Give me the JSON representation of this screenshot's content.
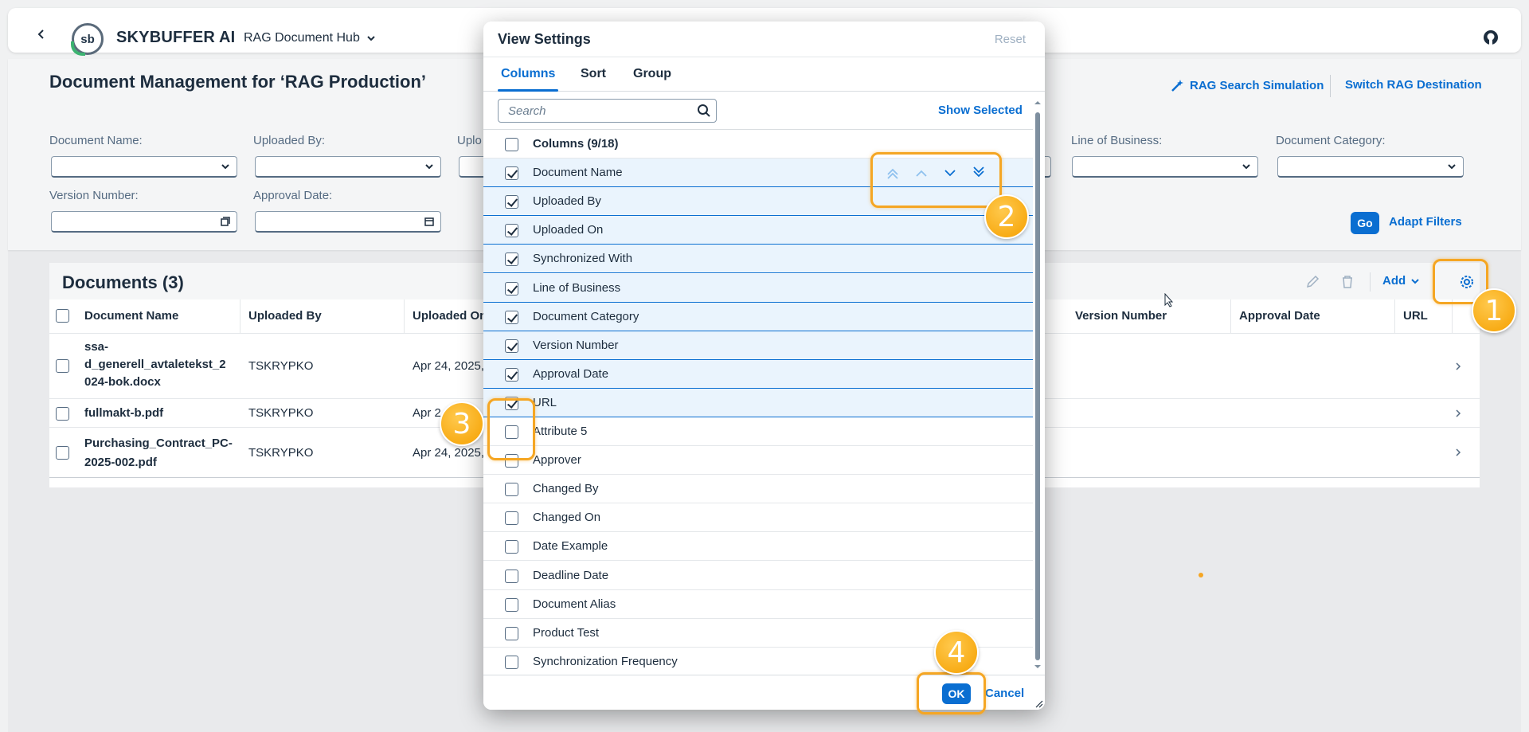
{
  "shell": {
    "brand": "SKYBUFFER AI",
    "logo_text": "sb",
    "product": "RAG Document Hub"
  },
  "page": {
    "title": "Document Management for ‘RAG Production’",
    "links": {
      "search_sim": "RAG Search Simulation",
      "switch_dest": "Switch RAG Destination"
    },
    "filters": {
      "document_name": "Document Name:",
      "uploaded_by": "Uploaded By:",
      "uploaded_on_partial": "Uplo",
      "line_of_business": "Line of Business:",
      "document_category": "Document Category:",
      "version_number": "Version Number:",
      "approval_date": "Approval Date:"
    },
    "go": "Go",
    "adapt_filters": "Adapt Filters"
  },
  "table": {
    "title": "Documents (3)",
    "add": "Add",
    "columns": {
      "document_name": "Document Name",
      "uploaded_by": "Uploaded By",
      "uploaded_on": "Uploaded On",
      "version_number": "Version Number",
      "approval_date": "Approval Date",
      "url": "URL"
    },
    "rows": [
      {
        "name_l1": "ssa-",
        "name_l2": "d_generell_avtaletekst_2",
        "name_l3": "024-bok.docx",
        "uploaded_by": "TSKRYPKO",
        "uploaded_on": "Apr 24, 2025,"
      },
      {
        "name_l1": "fullmakt-b.pdf",
        "name_l2": "",
        "name_l3": "",
        "uploaded_by": "TSKRYPKO",
        "uploaded_on": "Apr 2"
      },
      {
        "name_l1": "Purchasing_Contract_PC-",
        "name_l2": "2025-002.pdf",
        "name_l3": "",
        "uploaded_by": "TSKRYPKO",
        "uploaded_on": "Apr 24, 2025,"
      }
    ]
  },
  "dialog": {
    "title": "View Settings",
    "reset": "Reset",
    "tabs": [
      "Columns",
      "Sort",
      "Group"
    ],
    "search_placeholder": "Search",
    "show_selected": "Show Selected",
    "header_label": "Columns (9/18)",
    "items": [
      {
        "label": "Document Name",
        "checked": true
      },
      {
        "label": "Uploaded By",
        "checked": true
      },
      {
        "label": "Uploaded On",
        "checked": true
      },
      {
        "label": "Synchronized With",
        "checked": true
      },
      {
        "label": "Line of Business",
        "checked": true
      },
      {
        "label": "Document Category",
        "checked": true
      },
      {
        "label": "Version Number",
        "checked": true
      },
      {
        "label": "Approval Date",
        "checked": true
      },
      {
        "label": "URL",
        "checked": true
      },
      {
        "label": "Attribute 5",
        "checked": false
      },
      {
        "label": "Approver",
        "checked": false
      },
      {
        "label": "Changed By",
        "checked": false
      },
      {
        "label": "Changed On",
        "checked": false
      },
      {
        "label": "Date Example",
        "checked": false
      },
      {
        "label": "Deadline Date",
        "checked": false
      },
      {
        "label": "Document Alias",
        "checked": false
      },
      {
        "label": "Product Test",
        "checked": false
      },
      {
        "label": "Synchronization Frequency",
        "checked": false
      }
    ],
    "ok": "OK",
    "cancel": "Cancel"
  },
  "callouts": [
    "1",
    "2",
    "3",
    "4"
  ],
  "colors": {
    "accent": "#0a6ed1",
    "callout": "#f5a623",
    "selected_row": "#eaf4fd"
  }
}
